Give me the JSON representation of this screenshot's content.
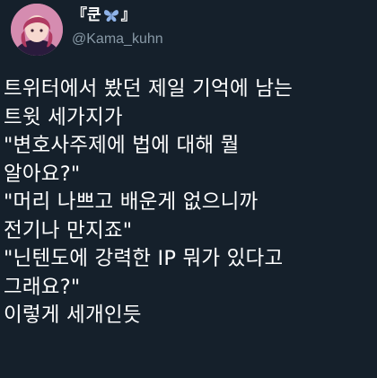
{
  "author": {
    "display_name_open": "『쿤",
    "display_name_close": "』",
    "display_name_icon": "butterfly-icon",
    "handle": "@Kama_kuhn"
  },
  "tweet": {
    "lines": [
      "트위터에서 봤던 제일 기억에 남는",
      "트윗 세가지가",
      "\"변호사주제에 법에 대해 뭘",
      "알아요?\"",
      "\"머리 나쁘고 배운게 없으니까",
      "전기나 만지죠\"",
      "\"닌텐도에 강력한 IP 뭐가 있다고",
      "그래요?\"",
      "이렇게 세개인듯"
    ]
  },
  "colors": {
    "background": "#15202b",
    "text": "#ffffff",
    "handle": "#8899a6",
    "butterfly": "#8fb3e8"
  }
}
